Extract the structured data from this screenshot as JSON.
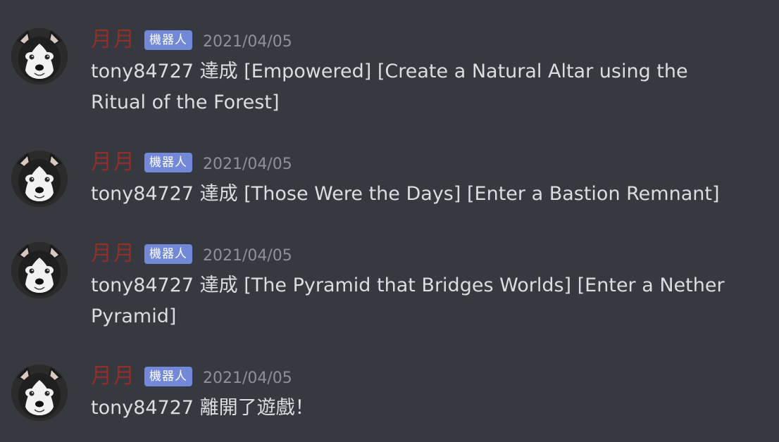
{
  "messages": [
    {
      "username": "月月",
      "badge": "機器人",
      "timestamp": "2021/04/05",
      "line1": "tony84727 達成 [Empowered] [Create a Natural Altar using the",
      "line2": "Ritual of the Forest]"
    },
    {
      "username": "月月",
      "badge": "機器人",
      "timestamp": "2021/04/05",
      "line1": "tony84727 達成 [Those Were the Days] [Enter a Bastion Remnant]",
      "line2": ""
    },
    {
      "username": "月月",
      "badge": "機器人",
      "timestamp": "2021/04/05",
      "line1": "tony84727 達成 [The Pyramid that Bridges Worlds] [Enter a Nether",
      "line2": "Pyramid]"
    },
    {
      "username": "月月",
      "badge": "機器人",
      "timestamp": "2021/04/05",
      "line1": "tony84727 離開了遊戲！",
      "line2": ""
    }
  ],
  "colors": {
    "background": "#36393f",
    "username": "#992d22",
    "badge": "#7289da",
    "timestamp": "#8e9297",
    "text": "#dcddde"
  },
  "icons": {
    "avatar": "husky-dog-avatar-icon"
  }
}
